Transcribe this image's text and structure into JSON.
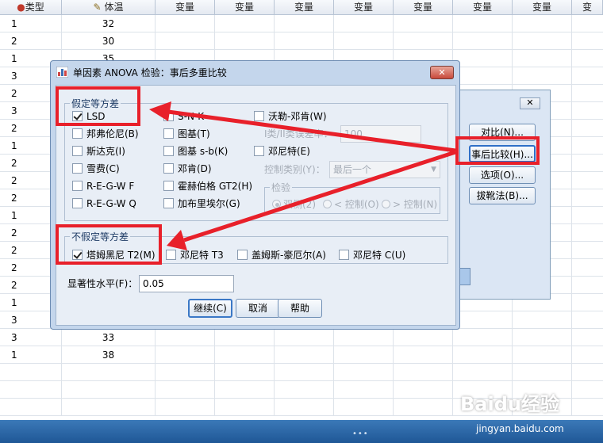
{
  "grid": {
    "headers": [
      "类型",
      "体温",
      "变量",
      "变量",
      "变量",
      "变量",
      "变量",
      "变量",
      "变量",
      "变量",
      "变"
    ],
    "col0": [
      "1",
      "2",
      "1",
      "3",
      "2",
      "3",
      "2",
      "1",
      "2",
      "2",
      "2",
      "1",
      "2",
      "2",
      "2",
      "2",
      "1",
      "3",
      "3",
      "1"
    ],
    "col1": [
      "32",
      "30",
      "35",
      "",
      "",
      "",
      "",
      "",
      "",
      "",
      "",
      "",
      "",
      "",
      "",
      "",
      "",
      "",
      "33",
      "38"
    ]
  },
  "parent_dialog": {
    "close": "✕",
    "buttons": [
      "对比(N)...",
      "事后比较(H)...",
      "选项(O)...",
      "拔靴法(B)..."
    ]
  },
  "dialog": {
    "title": "单因素 ANOVA 检验：事后多重比较",
    "close": "✕",
    "equal_group": {
      "legend": "假定等方差",
      "left": [
        {
          "label": "LSD",
          "checked": true
        },
        {
          "label": "邦弗伦尼(B)",
          "checked": false
        },
        {
          "label": "斯达克(I)",
          "checked": false
        },
        {
          "label": "雪费(C)",
          "checked": false
        },
        {
          "label": "R-E-G-W F",
          "checked": false
        },
        {
          "label": "R-E-G-W Q",
          "checked": false
        }
      ],
      "mid": [
        {
          "label": "S-N-K",
          "checked": false
        },
        {
          "label": "图基(T)",
          "checked": false
        },
        {
          "label": "图基 s-b(K)",
          "checked": false
        },
        {
          "label": "邓肯(D)",
          "checked": false
        },
        {
          "label": "霍赫伯格 GT2(H)",
          "checked": false
        },
        {
          "label": "加布里埃尔(G)",
          "checked": false
        }
      ],
      "waller": "沃勒-邓肯(W)",
      "error_ratio_label": "I类/II类误差率：",
      "error_ratio_value": "100",
      "dunnett": "邓尼特(E)",
      "control_label": "控制类别(Y)：",
      "control_value": "最后一个",
      "test_legend": "检验",
      "test_options": [
        "双侧(2)",
        "< 控制(O)",
        "> 控制(N)"
      ]
    },
    "unequal_group": {
      "legend": "不假定等方差",
      "items": [
        {
          "label": "塔姆黑尼 T2(M)",
          "checked": true
        },
        {
          "label": "邓尼特 T3",
          "checked": false
        },
        {
          "label": "盖姆斯-豪厄尔(A)",
          "checked": false
        },
        {
          "label": "邓尼特 C(U)",
          "checked": false
        }
      ]
    },
    "sig_label": "显著性水平(F)：",
    "sig_value": "0.05",
    "buttons": [
      "继续(C)",
      "取消",
      "帮助"
    ]
  },
  "watermark": "Baidu经验",
  "watermark_url": "jingyan.baidu.com",
  "colors": {
    "annotation": "#e8202a",
    "bottom_bar": "#2a66a8"
  }
}
